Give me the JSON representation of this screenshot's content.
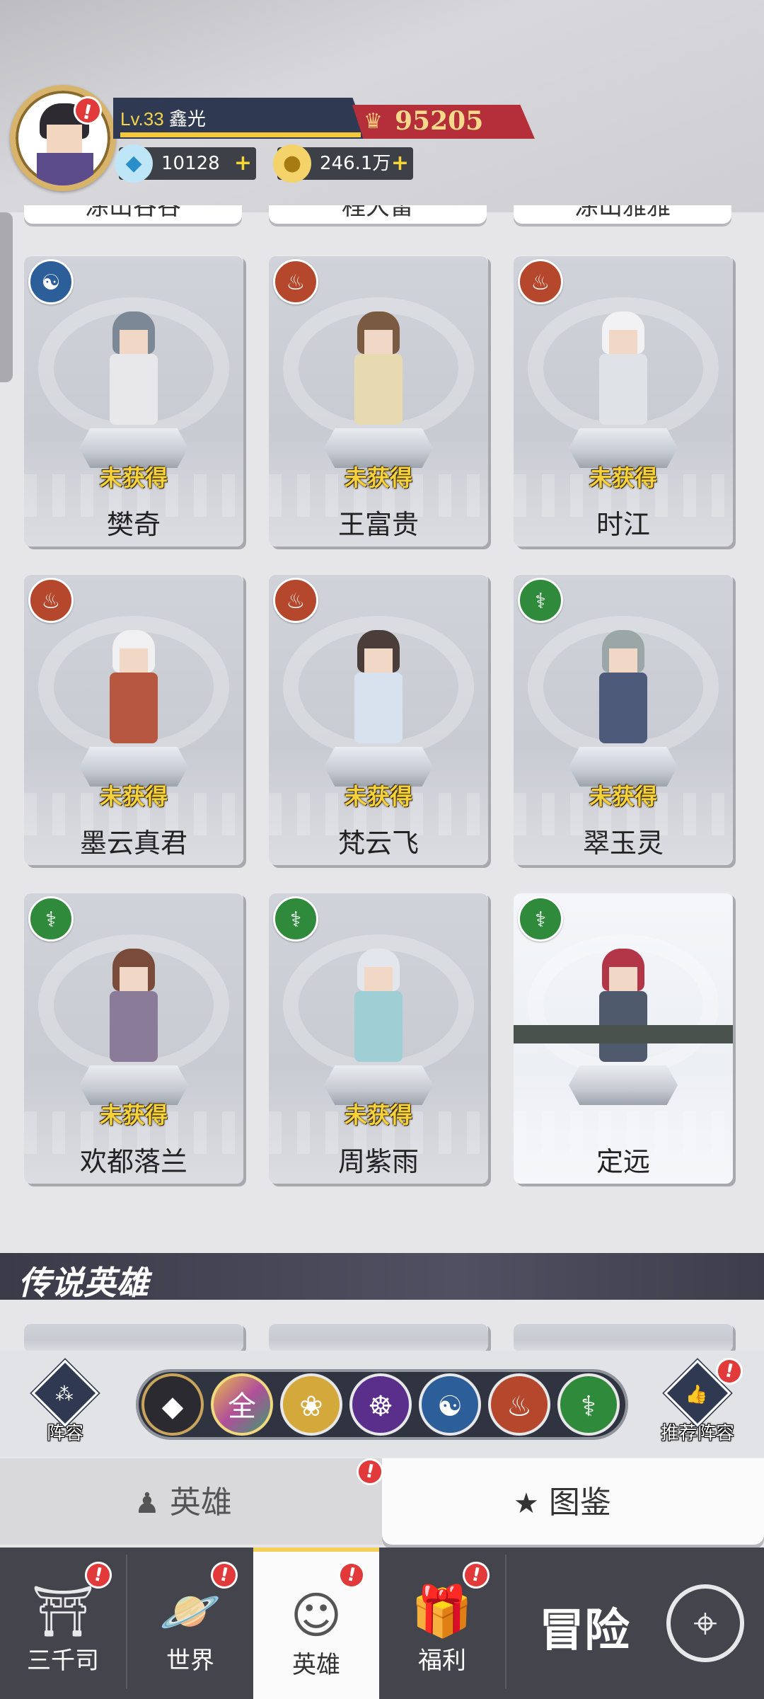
{
  "player": {
    "level_prefix": "Lv.33",
    "name": "鑫光",
    "power": "95205",
    "diamonds": "10128",
    "gold": "246.1万"
  },
  "top_partial_names": [
    "涂山谷谷",
    "程大雷",
    "涂山雅雅"
  ],
  "heroes": [
    {
      "name": "樊奇",
      "status": "未获得",
      "element": "water"
    },
    {
      "name": "王富贵",
      "status": "未获得",
      "element": "fire"
    },
    {
      "name": "时江",
      "status": "未获得",
      "element": "fire"
    },
    {
      "name": "墨云真君",
      "status": "未获得",
      "element": "fire"
    },
    {
      "name": "梵云飞",
      "status": "未获得",
      "element": "fire"
    },
    {
      "name": "翠玉灵",
      "status": "未获得",
      "element": "wood"
    },
    {
      "name": "欢都落兰",
      "status": "未获得",
      "element": "wood"
    },
    {
      "name": "周紫雨",
      "status": "未获得",
      "element": "wood"
    },
    {
      "name": "定远",
      "status": "",
      "element": "wood"
    }
  ],
  "legend_section": {
    "title": "传说英雄"
  },
  "filter_bar": {
    "lineup_label": "阵容",
    "recommend_label": "推荐阵容",
    "all_label": "全",
    "alert_mark": "!"
  },
  "tabs": {
    "hero": "英雄",
    "book": "图鉴"
  },
  "nav": {
    "sanqiansi": "三千司",
    "world": "世界",
    "hero": "英雄",
    "welfare": "福利",
    "adventure": "冒险"
  },
  "colors": {
    "accent_gold": "#f5d23c",
    "power_red": "#b52f3a",
    "alert_red": "#e23a3a"
  }
}
